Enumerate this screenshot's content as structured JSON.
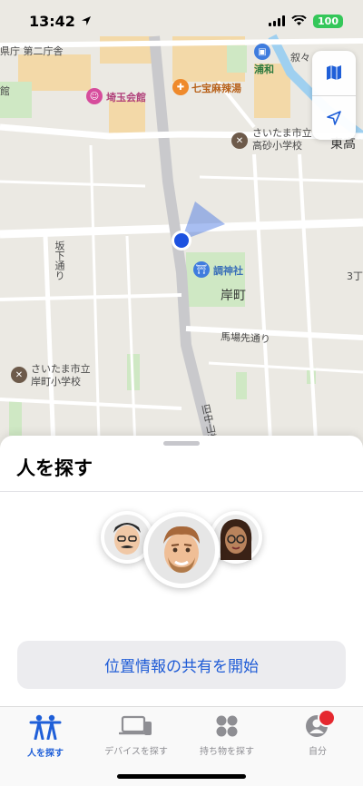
{
  "status": {
    "time": "13:42",
    "battery": "100"
  },
  "map": {
    "labels": {
      "prefecture_office": "県庁 第二庁舎",
      "urawa": "浦和",
      "kanji_top_right": "叙々",
      "kan": "館",
      "saitama_kaikan": "埼玉会館",
      "shichiho": "七宝麻辣湯",
      "takasago_school": "さいたま市立\n高砂小学校",
      "higashi": "東高",
      "sakashita": "坂下通り",
      "tsuki_shrine": "調神社",
      "kishicho": "岸町",
      "three_chome": "3丁",
      "babasaki": "馬場先通り",
      "kishicho_school": "さいたま市立\n岸町小学校",
      "road_vertical": "旧中山道"
    }
  },
  "map_controls": {
    "map_mode_icon": "map-icon",
    "location_icon": "location-arrow-icon"
  },
  "sheet": {
    "title": "人を探す",
    "share_button": "位置情報の共有を開始"
  },
  "tabs": [
    {
      "label": "人を探す",
      "icon": "people-icon",
      "active": true
    },
    {
      "label": "デバイスを探す",
      "icon": "devices-icon",
      "active": false
    },
    {
      "label": "持ち物を探す",
      "icon": "items-icon",
      "active": false
    },
    {
      "label": "自分",
      "icon": "person-icon",
      "active": false
    }
  ],
  "colors": {
    "accent": "#1f5fd8",
    "badge": "#e5282f",
    "battery": "#34c759"
  }
}
